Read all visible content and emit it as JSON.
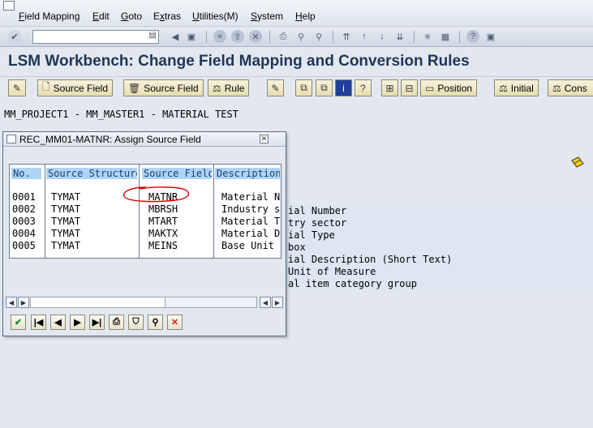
{
  "menubar": {
    "items": [
      {
        "label": "Field Mapping",
        "underline": "F"
      },
      {
        "label": "Edit",
        "underline": "E"
      },
      {
        "label": "Goto",
        "underline": "G"
      },
      {
        "label": "Extras",
        "underline": "x"
      },
      {
        "label": "Utilities(M)",
        "underline": "U"
      },
      {
        "label": "System",
        "underline": "S"
      },
      {
        "label": "Help",
        "underline": "H"
      }
    ]
  },
  "stdbar": {
    "command_field_value": "",
    "icons": [
      "enter-icon",
      "back-icon",
      "save-icon",
      "back-arrow-icon",
      "exit-icon",
      "cancel-icon",
      "print-icon",
      "find-icon",
      "find-next-icon",
      "first-page-icon",
      "prev-page-icon",
      "next-page-icon",
      "last-page-icon",
      "new-session-icon",
      "shortcut-icon",
      "help-icon",
      "layout-icon"
    ]
  },
  "title": "LSM Workbench: Change Field Mapping and Conversion Rules",
  "appbar": {
    "buttons": [
      {
        "label": "Source Field",
        "icon": "document-icon"
      },
      {
        "label": "Source Field",
        "icon": "trash-icon"
      },
      {
        "label": "Rule",
        "icon": "rule-icon"
      },
      {
        "label": "Position",
        "icon": "position-icon"
      },
      {
        "label": "Initial",
        "icon": "rule-icon"
      },
      {
        "label": "Cons",
        "icon": "rule-icon"
      }
    ]
  },
  "header_line": "MM_PROJECT1 - MM_MASTER1 - MATERIAL TEST",
  "background_list": [
    "ial Number",
    "try sector",
    "ial Type",
    "box",
    "ial Description (Short Text)",
    "Unit of Measure",
    "al item category group"
  ],
  "popup": {
    "title": "REC_MM01-MATNR: Assign Source Field",
    "columns": [
      "No.",
      "Source Structure",
      "Source Field",
      "Description"
    ],
    "rows": [
      {
        "no": "0001",
        "structure": "TYMAT",
        "field": "MATNR",
        "desc": "Material N"
      },
      {
        "no": "0002",
        "structure": "TYMAT",
        "field": "MBRSH",
        "desc": "Industry s"
      },
      {
        "no": "0003",
        "structure": "TYMAT",
        "field": "MTART",
        "desc": "Material T"
      },
      {
        "no": "0004",
        "structure": "TYMAT",
        "field": "MAKTX",
        "desc": "Material D"
      },
      {
        "no": "0005",
        "structure": "TYMAT",
        "field": "MEINS",
        "desc": "Base Unit"
      }
    ],
    "toolbar_icons": [
      "check-icon",
      "first-icon",
      "prev-icon",
      "next-icon",
      "last-icon",
      "print-icon",
      "filter-icon",
      "find-icon",
      "cancel-icon"
    ]
  },
  "colors": {
    "title": "#1f3656",
    "header_fill": "#aed4f6",
    "annotation": "#e00000",
    "cancel": "#d02020",
    "check": "#1f8a1f"
  }
}
